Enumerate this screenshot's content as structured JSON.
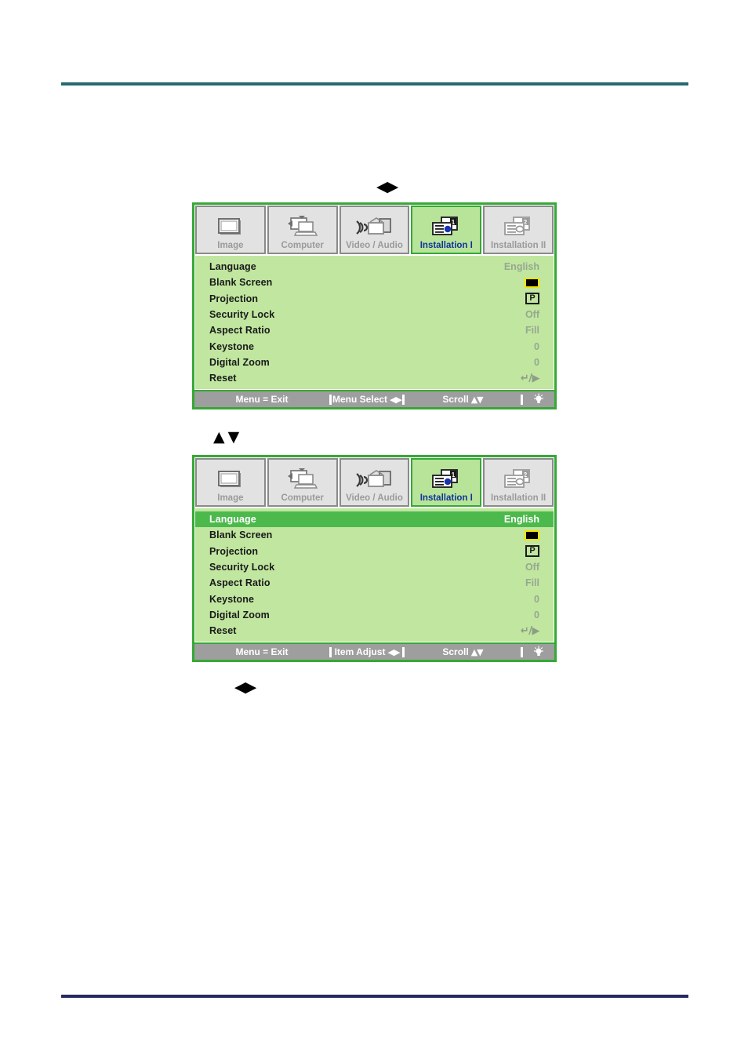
{
  "page": {
    "rule_top_color": "#246a6e",
    "rule_bottom_color": "#262a60"
  },
  "hints": {
    "left_right": "◀▶",
    "up_down": "▲ ▼",
    "left_right_2": "◀▶"
  },
  "osd": {
    "accent_green": "#36a836",
    "body_green": "#c0e6a0",
    "selected_green": "#4cb94c",
    "tabs": [
      {
        "label": "Image",
        "icon": "screen-icon",
        "active": false
      },
      {
        "label": "Computer",
        "icon": "laptop-icon",
        "active": false
      },
      {
        "label": "Video / Audio",
        "icon": "video-audio-icon",
        "active": false
      },
      {
        "label": "Installation I",
        "icon": "installation-one-icon",
        "active": true
      },
      {
        "label": "Installation II",
        "icon": "installation-two-icon",
        "active": false
      }
    ],
    "rows": [
      {
        "label": "Language",
        "value": "English",
        "type": "text"
      },
      {
        "label": "Blank Screen",
        "value": "",
        "type": "swatch",
        "swatch_fill": "#000000",
        "swatch_border": "#f2e400"
      },
      {
        "label": "Projection",
        "value": "P",
        "type": "badge"
      },
      {
        "label": "Security Lock",
        "value": "Off",
        "type": "text"
      },
      {
        "label": "Aspect Ratio",
        "value": "Fill",
        "type": "text"
      },
      {
        "label": "Keystone",
        "value": "0",
        "type": "text"
      },
      {
        "label": "Digital Zoom",
        "value": "0",
        "type": "text"
      },
      {
        "label": "Reset",
        "value": "↵/▶",
        "type": "glyph"
      }
    ],
    "footer_1": {
      "exit": "Menu = Exit",
      "middle": "Menu Select",
      "middle_arrows": "◀▶",
      "scroll": "Scroll",
      "scroll_arrows": "▲▼",
      "lamp": "lamp-icon"
    },
    "footer_2": {
      "exit": "Menu = Exit",
      "middle": "Item Adjust",
      "middle_arrows": "◀▶",
      "scroll": "Scroll",
      "scroll_arrows": "▲▼",
      "lamp": "lamp-icon"
    },
    "selected_row_index_panel2": 0
  }
}
